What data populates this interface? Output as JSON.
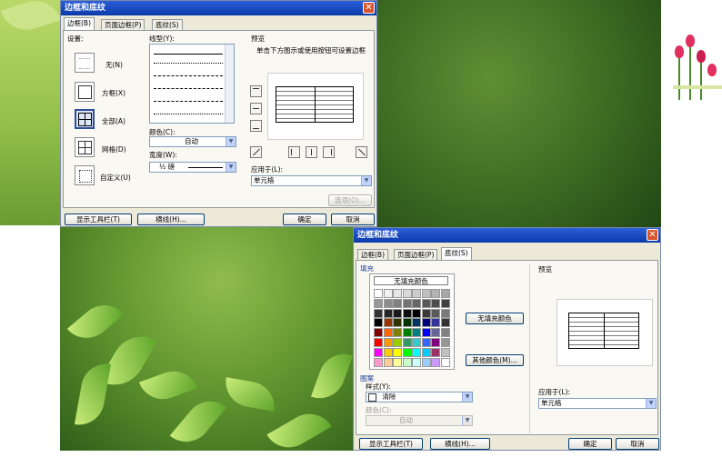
{
  "dialog1": {
    "title": "边框和底纹",
    "tabs": [
      "边框(B)",
      "页面边框(P)",
      "底纹(S)"
    ],
    "setting_label": "设置:",
    "settings": [
      "无(N)",
      "方框(X)",
      "全部(A)",
      "网格(D)",
      "自定义(U)"
    ],
    "linestyle_label": "线型(Y):",
    "color_label": "颜色(C):",
    "color_value": "自动",
    "width_label": "宽度(W):",
    "width_value": "½ 磅",
    "preview_label": "预览",
    "preview_hint": "单击下方图示或使用按钮可设置边框",
    "apply_label": "应用于(L):",
    "apply_value": "单元格",
    "options_button": "选项(O)...",
    "toolbar_button": "显示工具栏(T)",
    "hline_button": "横线(H)...",
    "ok_button": "确定",
    "cancel_button": "取消"
  },
  "dialog2": {
    "title": "边框和底纹",
    "tabs": [
      "边框(B)",
      "页面边框(P)",
      "底纹(S)"
    ],
    "fill_label": "填充",
    "no_fill_swatch": "无填充颜色",
    "no_fill_text": "无填充颜色",
    "more_colors_button": "其他颜色(M)...",
    "pattern_label": "图案",
    "style_label": "样式(Y):",
    "style_value": "清除",
    "pcolor_label": "颜色(C):",
    "pcolor_value": "自动",
    "preview_label": "预览",
    "apply_label": "应用于(L):",
    "apply_value": "单元格",
    "toolbar_button": "显示工具栏(T)",
    "hline_button": "横线(H)...",
    "ok_button": "确定",
    "cancel_button": "取消"
  },
  "palette": [
    [
      "#ffffff",
      "#f2f2f2",
      "#e6e6e6",
      "#d9d9d9",
      "#cccccc",
      "#bfbfbf",
      "#b3b3b3",
      "#a6a6a6"
    ],
    [
      "#999999",
      "#8c8c8c",
      "#808080",
      "#737373",
      "#666666",
      "#595959",
      "#4d4d4d",
      "#404040"
    ],
    [
      "#333333",
      "#262626",
      "#1a1a1a",
      "#0d0d0d",
      "#000000",
      "#3a3a3a",
      "#5a5a5a",
      "#7a7a7a"
    ],
    [
      "#000000",
      "#993300",
      "#333300",
      "#003300",
      "#003366",
      "#000080",
      "#333399",
      "#333333"
    ],
    [
      "#800000",
      "#ff6600",
      "#808000",
      "#008000",
      "#008080",
      "#0000ff",
      "#666699",
      "#808080"
    ],
    [
      "#ff0000",
      "#ff9900",
      "#99cc00",
      "#339966",
      "#33cccc",
      "#3366ff",
      "#800080",
      "#969696"
    ],
    [
      "#ff00ff",
      "#ffcc00",
      "#ffff00",
      "#00ff00",
      "#00ffff",
      "#00ccff",
      "#993366",
      "#c0c0c0"
    ],
    [
      "#ff99cc",
      "#ffcc99",
      "#ffff99",
      "#ccffcc",
      "#ccffff",
      "#99ccff",
      "#cc99ff",
      "#ffffff"
    ]
  ],
  "colors": {
    "titlebar": "#0a3aa8",
    "dialog_bg": "#ece9d8",
    "highlight": "#2b4e9c"
  }
}
